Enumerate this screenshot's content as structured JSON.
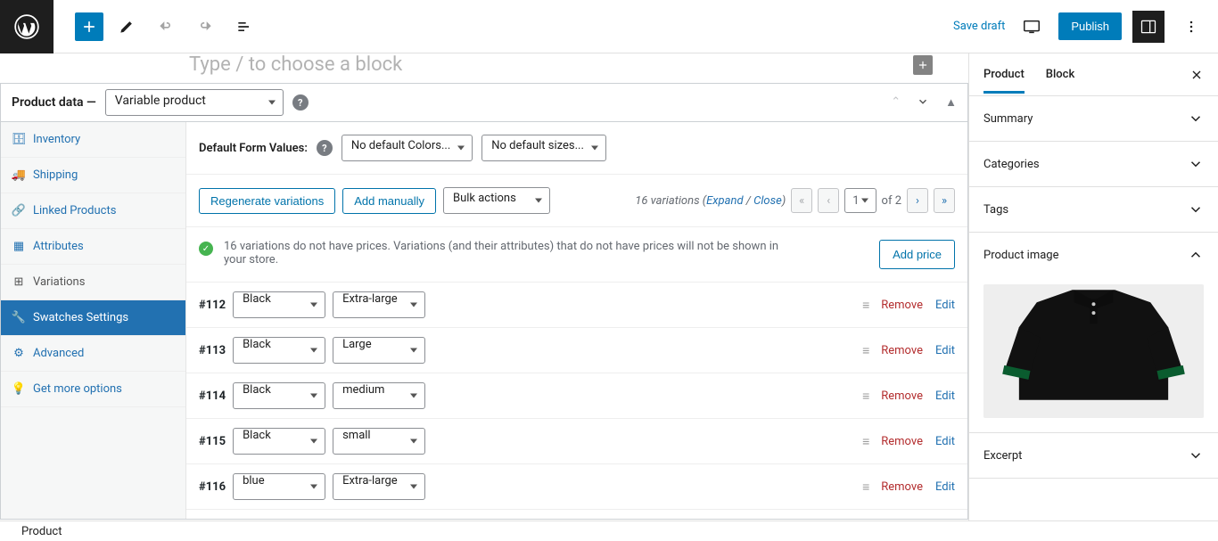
{
  "top": {
    "save_draft": "Save draft",
    "publish": "Publish"
  },
  "block_prompt": "Type / to choose a block",
  "product_data": {
    "label": "Product data —",
    "type": "Variable product"
  },
  "tabs": {
    "inventory": "Inventory",
    "shipping": "Shipping",
    "linked": "Linked Products",
    "attributes": "Attributes",
    "variations": "Variations",
    "swatches": "Swatches Settings",
    "advanced": "Advanced",
    "more": "Get more options"
  },
  "form_defaults": {
    "label": "Default Form Values:",
    "colors": "No default Colors...",
    "sizes": "No default sizes..."
  },
  "var_toolbar": {
    "regenerate": "Regenerate variations",
    "add_manually": "Add manually",
    "bulk": "Bulk actions",
    "count_text": "16 variations",
    "expand": "Expand",
    "close": "Close",
    "page": "1",
    "of": "of 2"
  },
  "notice": {
    "text": "16 variations do not have prices. Variations (and their attributes) that do not have prices will not be shown in your store.",
    "add_price": "Add price"
  },
  "variations": [
    {
      "id": "#112",
      "color": "Black",
      "size": "Extra-large"
    },
    {
      "id": "#113",
      "color": "Black",
      "size": "Large"
    },
    {
      "id": "#114",
      "color": "Black",
      "size": "medium"
    },
    {
      "id": "#115",
      "color": "Black",
      "size": "small"
    },
    {
      "id": "#116",
      "color": "blue",
      "size": "Extra-large"
    }
  ],
  "row_labels": {
    "remove": "Remove",
    "edit": "Edit"
  },
  "sidebar": {
    "tab_product": "Product",
    "tab_block": "Block",
    "summary": "Summary",
    "categories": "Categories",
    "tags": "Tags",
    "product_image": "Product image",
    "excerpt": "Excerpt"
  },
  "statusbar": "Product"
}
